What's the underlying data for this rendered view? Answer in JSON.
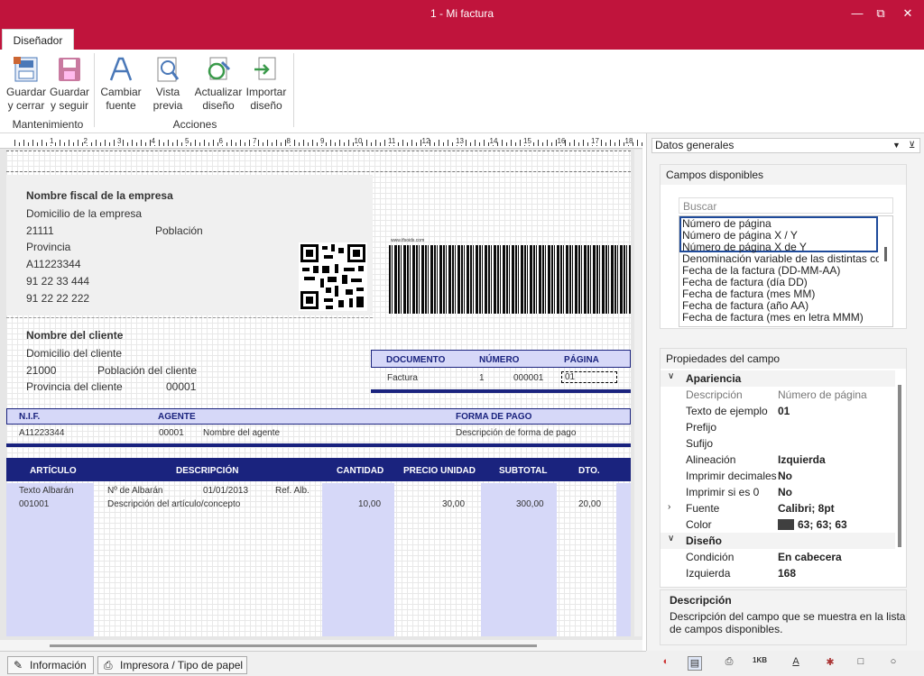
{
  "window": {
    "title": "1 - Mi factura"
  },
  "tabs": [
    "Diseñador"
  ],
  "ribbon": {
    "save_close": "Guardar\ny cerrar",
    "save_close_1": "Guardar",
    "save_close_2": "y cerrar",
    "save_cont_1": "Guardar",
    "save_cont_2": "y seguir",
    "font_1": "Cambiar",
    "font_2": "fuente",
    "preview_1": "Vista",
    "preview_2": "previa",
    "update_1": "Actualizar",
    "update_2": "diseño",
    "import_1": "Importar",
    "import_2": "diseño",
    "group_maint": "Mantenimiento",
    "group_actions": "Acciones"
  },
  "ruler": [
    "1",
    "2",
    "3",
    "4",
    "5",
    "6",
    "7",
    "8",
    "9",
    "10",
    "11",
    "12",
    "13",
    "14",
    "15",
    "16",
    "17",
    "18"
  ],
  "invoice": {
    "company_name": "Nombre fiscal de la empresa",
    "company_address": "Domicilio de la empresa",
    "company_zip": "21111",
    "company_city": "Población",
    "company_province": "Provincia",
    "company_nif": "A11223344",
    "company_phone1": "91 22 33 444",
    "company_phone2": "91 22 22 222",
    "barcode_url": "www.tfsoids.com",
    "client_name": "Nombre del cliente",
    "client_address": "Domicilio del cliente",
    "client_zip": "21000",
    "client_city": "Población del cliente",
    "client_province": "Provincia del cliente",
    "client_code": "00001",
    "doc_h1": "DOCUMENTO",
    "doc_h2": "NÚMERO",
    "doc_h3": "PÁGINA",
    "doc_v1": "Factura",
    "doc_v2a": "1",
    "doc_v2b": "000001",
    "doc_v3": "01",
    "nif_h": "N.I.F.",
    "agent_h": "AGENTE",
    "payment_h": "FORMA DE PAGO",
    "nif_v": "A11223344",
    "agent_code": "00001",
    "agent_name": "Nombre del agente",
    "payment_v": "Descripción de forma de pago",
    "col_article": "ARTÍCULO",
    "col_desc": "DESCRIPCIÓN",
    "col_qty": "CANTIDAD",
    "col_price": "PRECIO UNIDAD",
    "col_subtotal": "SUBTOTAL",
    "col_dto": "DTO.",
    "row_ref": "Texto Albarán",
    "row_code": "001001",
    "row_albaran": "Nº de Albarán",
    "row_date": "01/01/2013",
    "row_refalb": "Ref. Alb.",
    "row_desc": "Descripción del artículo/concepto",
    "row_qty": "10,00",
    "row_price": "30,00",
    "row_subtotal": "300,00",
    "row_dto": "20,00"
  },
  "status": {
    "info": "Información",
    "printer": "Impresora / Tipo de papel"
  },
  "panel": {
    "dropdown": "Datos generales",
    "fields_title": "Campos disponibles",
    "search_placeholder": "Buscar",
    "fields": [
      "Número de página",
      "Número de página X / Y",
      "Número de página X de Y",
      "Denominación variable de las distintas copias",
      "Fecha de la factura (DD-MM-AA)",
      "Fecha de factura (día DD)",
      "Fecha de factura (mes MM)",
      "Fecha de factura (año AA)",
      "Fecha de factura (mes en letra MMM)"
    ],
    "props_title": "Propiedades del campo",
    "sec_appearance": "Apariencia",
    "sec_design": "Diseño",
    "props": [
      {
        "k": "Descripción",
        "v": "Número de página"
      },
      {
        "k": "Texto de ejemplo",
        "v": "01"
      },
      {
        "k": "Prefijo",
        "v": ""
      },
      {
        "k": "Sufijo",
        "v": ""
      },
      {
        "k": "Alineación",
        "v": "Izquierda"
      },
      {
        "k": "Imprimir decimales",
        "v": "No"
      },
      {
        "k": "Imprimir si es 0",
        "v": "No"
      },
      {
        "k": "Fuente",
        "v": "Calibri; 8pt"
      },
      {
        "k": "Color",
        "v": "63; 63; 63"
      }
    ],
    "props2": [
      {
        "k": "Condición",
        "v": "En cabecera"
      },
      {
        "k": "Izquierda",
        "v": "168"
      }
    ],
    "desc_title": "Descripción",
    "desc_text1": "Descripción del campo que se muestra en la lista",
    "desc_text2": "de campos disponibles."
  },
  "colors": {
    "accent": "#c0143c",
    "navy": "#1a237e",
    "band": "#d6d8f8"
  }
}
